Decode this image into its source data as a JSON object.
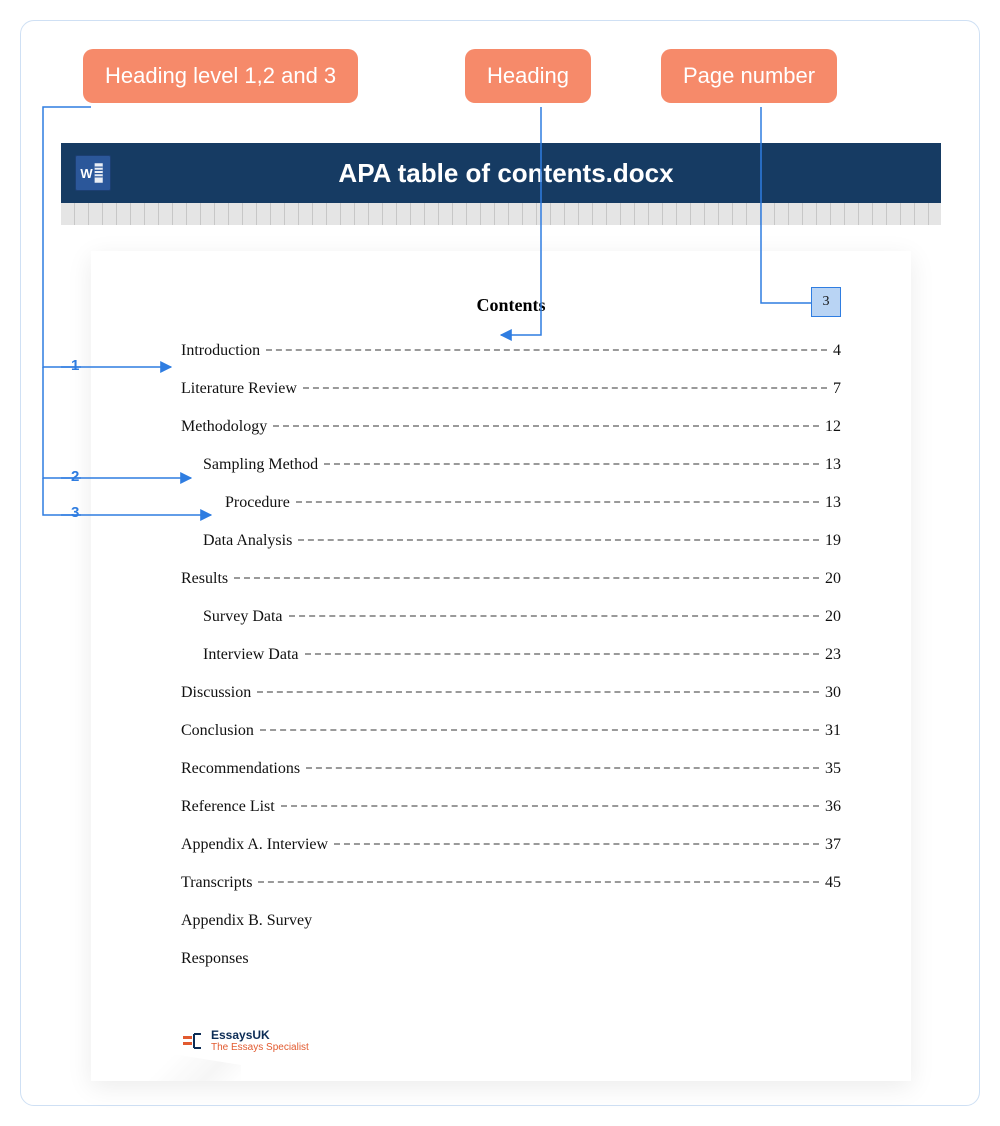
{
  "callouts": {
    "levels": "Heading level 1,2 and 3",
    "heading": "Heading",
    "page": "Page number"
  },
  "titlebar": {
    "filename": "APA table of contents.docx",
    "icon_letter": "W"
  },
  "page_number_box": "3",
  "contents_title": "Contents",
  "level_labels": {
    "l1": "1",
    "l2": "2",
    "l3": "3"
  },
  "toc": [
    {
      "label": "Introduction",
      "page": "4",
      "level": 1
    },
    {
      "label": "Literature Review",
      "page": "7",
      "level": 1
    },
    {
      "label": "Methodology",
      "page": "12",
      "level": 1
    },
    {
      "label": "Sampling Method",
      "page": "13",
      "level": 2
    },
    {
      "label": "Procedure",
      "page": "13",
      "level": 3
    },
    {
      "label": "Data Analysis",
      "page": "19",
      "level": 2
    },
    {
      "label": "Results",
      "page": "20",
      "level": 1
    },
    {
      "label": "Survey Data",
      "page": "20",
      "level": 2
    },
    {
      "label": "Interview Data",
      "page": "23",
      "level": 2
    },
    {
      "label": "Discussion",
      "page": "30",
      "level": 1
    },
    {
      "label": "Conclusion",
      "page": "31",
      "level": 1
    },
    {
      "label": "Recommendations",
      "page": "35",
      "level": 1
    },
    {
      "label": "Reference List",
      "page": "36",
      "level": 1
    },
    {
      "label": "Appendix A. Interview",
      "page": "37",
      "level": 1
    },
    {
      "label": "Transcripts",
      "page": "45",
      "level": 1
    },
    {
      "label": "Appendix B. Survey",
      "page": "",
      "level": 1
    },
    {
      "label": "Responses",
      "page": "",
      "level": 1
    }
  ],
  "brand": {
    "line1": "EssaysUK",
    "line2": "The Essays Specialist"
  }
}
